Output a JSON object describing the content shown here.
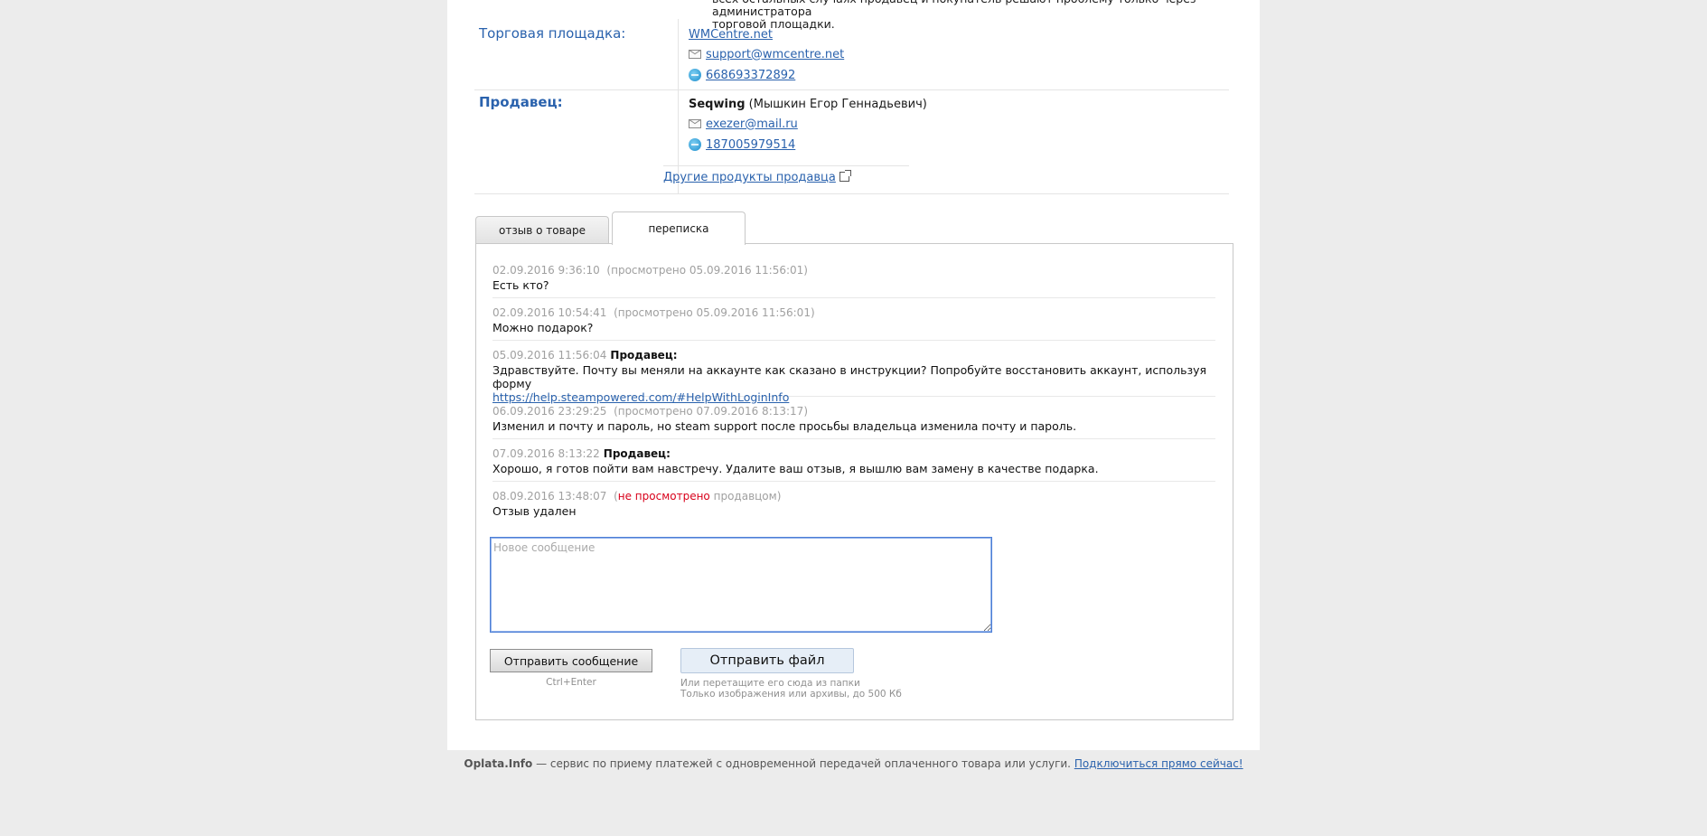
{
  "top_cut_text": {
    "line1": "всех остальных случаях продавец и покупатель решают проблему только через администратора",
    "line2": "торговой площадки."
  },
  "marketplace": {
    "label": "Торговая площадка:",
    "site": "WMCentre.net",
    "email": "support@wmcentre.net",
    "wmid": "668693372892"
  },
  "seller": {
    "label": "Продавец:",
    "nick": "Seqwing",
    "full_name": "(Мышкин Егор Геннадьевич)",
    "email": "exezer@mail.ru",
    "wmid": "187005979514",
    "other_products": "Другие продукты продавца"
  },
  "tabs": [
    {
      "label": "отзыв о товаре",
      "active": false
    },
    {
      "label": "переписка",
      "active": true
    }
  ],
  "messages": [
    {
      "date": "02.09.2016 9:36:10",
      "status": "(просмотрено 05.09.2016 11:56:01)",
      "author": "",
      "text": "Есть кто?"
    },
    {
      "date": "02.09.2016 10:54:41",
      "status": "(просмотрено 05.09.2016 11:56:01)",
      "author": "",
      "text": "Можно подарок?"
    },
    {
      "date": "05.09.2016 11:56:04",
      "status": "",
      "author": "Продавец:",
      "text": "Здравствуйте. Почту вы меняли на аккаунте как сказано в инструкции? Попробуйте восстановить аккаунт, используя форму",
      "link": "https://help.steampowered.com/#HelpWithLoginInfo"
    },
    {
      "date": "06.09.2016 23:29:25",
      "status": "(просмотрено 07.09.2016 8:13:17)",
      "author": "",
      "text": "Изменил и почту и пароль, но steam support после просьбы владельца изменила почту и пароль."
    },
    {
      "date": "07.09.2016 8:13:22",
      "status": "",
      "author": "Продавец:",
      "text": "Хорошо, я готов пойти вам навстречу. Удалите ваш отзыв, я вышлю вам замену в качестве подарка."
    },
    {
      "date": "08.09.2016 13:48:07",
      "status_prefix": "(",
      "status_unread": "не просмотрено",
      "status_suffix": "продавцом)",
      "author": "",
      "text": "Отзыв удален"
    }
  ],
  "compose": {
    "placeholder": "Новое сообщение",
    "send_label": "Отправить сообщение",
    "hotkey": "Ctrl+Enter",
    "file_label": "Отправить файл",
    "file_hint_1": "Или перетащите его сюда из папки",
    "file_hint_2": "Только изображения или архивы, до 500 Кб"
  },
  "footer": {
    "brand": "Oplata.Info",
    "text": " — сервис по приему платежей с одновременной передачей оплаченного товара или услуги. ",
    "link": "Подключиться прямо сейчас!"
  },
  "colors": {
    "link": "#2a62ad",
    "unread": "#d8001a",
    "background": "#ececec"
  }
}
